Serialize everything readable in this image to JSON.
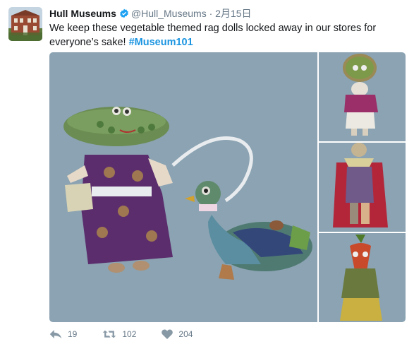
{
  "tweet": {
    "display_name": "Hull Museums",
    "handle": "@Hull_Museums",
    "separator": "·",
    "date": "2月15日",
    "text": "We keep these vegetable themed rag dolls locked away in our stores for everyone’s sake! ",
    "hashtag": "#Museum101"
  },
  "actions": {
    "replies": "19",
    "retweets": "102",
    "likes": "204"
  },
  "colors": {
    "hashtag": "#1b95e0",
    "verified": "#1da1f2",
    "photo_background": "#8aa2b1",
    "muted_text": "#657786"
  }
}
